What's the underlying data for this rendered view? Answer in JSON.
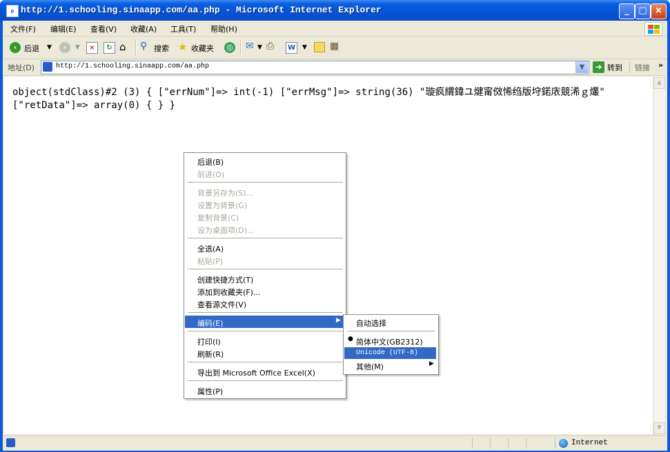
{
  "window": {
    "title": "http://1.schooling.sinaapp.com/aa.php - Microsoft Internet Explorer",
    "minimize_glyph": "_",
    "maximize_glyph": "□",
    "close_glyph": "×"
  },
  "menubar": {
    "items": [
      {
        "label": "文件(F)"
      },
      {
        "label": "编辑(E)"
      },
      {
        "label": "查看(V)"
      },
      {
        "label": "收藏(A)"
      },
      {
        "label": "工具(T)"
      },
      {
        "label": "帮助(H)"
      }
    ]
  },
  "toolbar": {
    "back_label": "后退",
    "search_label": "搜索",
    "favorites_label": "收藏夹"
  },
  "addressbar": {
    "label": "地址(D)",
    "url": "http://1.schooling.sinaapp.com/aa.php",
    "go_label": "转到",
    "links_label": "链接"
  },
  "page": {
    "body_text": "object(stdClass)#2 (3) { [\"errNum\"]=> int(-1) [\"errMsg\"]=> string(36) \"璇疯緭鍏ユ煡甯傚悕绉版垨鍩庡競浠ｇ爜\" [\"retData\"]=> array(0) { } }"
  },
  "context_menu": {
    "items": [
      {
        "label": "后退(B)",
        "enabled": true
      },
      {
        "label": "前进(O)",
        "enabled": false
      },
      {
        "label": "背景另存为(S)...",
        "enabled": false
      },
      {
        "label": "设置为背景(G)",
        "enabled": false
      },
      {
        "label": "复制背景(C)",
        "enabled": false
      },
      {
        "label": "设为桌面项(D)...",
        "enabled": false
      },
      {
        "label": "全选(A)",
        "enabled": true
      },
      {
        "label": "粘贴(P)",
        "enabled": false
      },
      {
        "label": "创建快捷方式(T)",
        "enabled": true
      },
      {
        "label": "添加到收藏夹(F)...",
        "enabled": true
      },
      {
        "label": "查看源文件(V)",
        "enabled": true
      },
      {
        "label": "编码(E)",
        "enabled": true,
        "highlighted": true
      },
      {
        "label": "打印(I)",
        "enabled": true
      },
      {
        "label": "刷新(R)",
        "enabled": true
      },
      {
        "label": "导出到 Microsoft Office Excel(X)",
        "enabled": true
      },
      {
        "label": "属性(P)",
        "enabled": true
      }
    ]
  },
  "encoding_submenu": {
    "items": [
      {
        "label": "自动选择"
      },
      {
        "label": "简体中文(GB2312)",
        "checked": true
      },
      {
        "label": "Unicode (UTF-8)",
        "highlighted": true
      },
      {
        "label": "其他(M)"
      }
    ]
  },
  "statusbar": {
    "zone": "Internet"
  },
  "colors": {
    "titlebar": "#0553d7",
    "chrome": "#ece9d8",
    "highlight": "#316ac5"
  }
}
